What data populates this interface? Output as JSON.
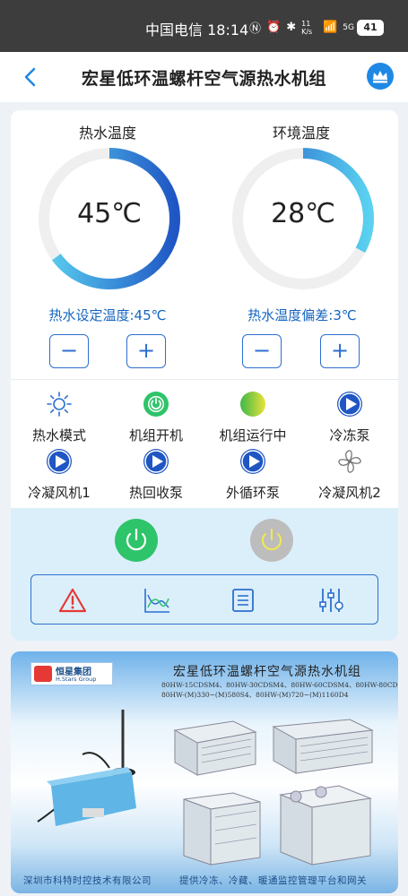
{
  "status_bar": {
    "carrier_time": "中国电信 18:14",
    "network_speed": "11 K/s",
    "signal": "5G",
    "battery": "41"
  },
  "header": {
    "title": "宏星低环温螺杆空气源热水机组"
  },
  "gauges": [
    {
      "title": "热水温度",
      "value": "45℃",
      "level": 0.65,
      "setting_label": "热水设定温度:45℃"
    },
    {
      "title": "环境温度",
      "value": "28℃",
      "level": 0.33,
      "setting_label": "热水温度偏差:3℃"
    }
  ],
  "stepper": {
    "minus": "−",
    "plus": "+"
  },
  "status_items": [
    {
      "label": "热水模式",
      "icon": "sun-icon"
    },
    {
      "label": "机组开机",
      "icon": "power-on-icon"
    },
    {
      "label": "机组运行中",
      "icon": "running-indicator-icon"
    },
    {
      "label": "冷冻泵",
      "icon": "play-icon"
    },
    {
      "label": "冷凝风机1",
      "icon": "play-icon"
    },
    {
      "label": "热回收泵",
      "icon": "play-icon"
    },
    {
      "label": "外循环泵",
      "icon": "play-icon"
    },
    {
      "label": "冷凝风机2",
      "icon": "fan-icon"
    }
  ],
  "colors": {
    "accent": "#2d6fd0",
    "gauge_light": "#5ad1f0",
    "gauge_dark": "#1f56c4",
    "power_on": "#2ec46a",
    "power_off": "#bdbdbd"
  },
  "banner": {
    "brand": "恒星集团",
    "brand_en": "H.Stars Group",
    "title": "宏星低环温螺杆空气源热水机组",
    "models_line1": "80HW-15CDSM4、80HW-30CDSM4、80HW-60CDSM4、80HW-80CDSM4",
    "models_line2": "80HW-(M)330~(M)580S4、80HW-(M)720~(M)1160D4",
    "footer_left": "深圳市科特时控技术有限公司",
    "footer_right": "提供冷冻、冷藏、暖通监控管理平台和网关"
  }
}
